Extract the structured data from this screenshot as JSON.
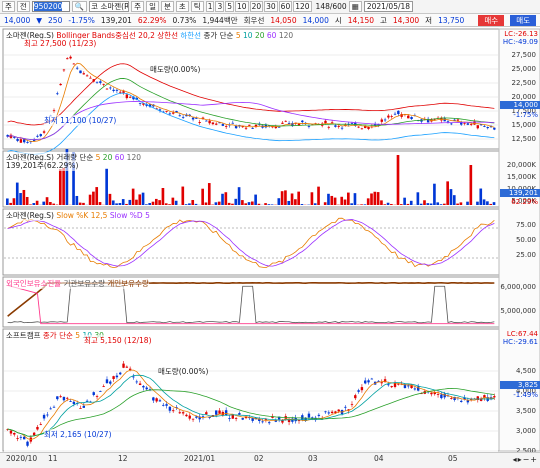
{
  "toolbar": {
    "menu_label": "주",
    "menu2_label": "전",
    "code": "950200",
    "name_short": "코 소마젠(Reg",
    "btn_ju": "주",
    "btn_il": "일",
    "btn_bun": "분",
    "btn_cho": "초",
    "btn_tick": "틱",
    "periods": [
      "1",
      "3",
      "5",
      "10",
      "20",
      "30",
      "60",
      "120"
    ],
    "ratio": "148/600",
    "date": "2021/05/18"
  },
  "quote": {
    "price": "14,000",
    "arrow": "▼",
    "change": "250",
    "pct": "-1.75%",
    "volume": "139,201",
    "vol_ratio": "62.29%",
    "turnover": "0.73%",
    "amount": "1,944백만",
    "label_hoejeon": "회우선",
    "bid": "14,050",
    "ask": "14,000",
    "open_label": "시",
    "open": "14,150",
    "high_label": "고",
    "high": "14,300",
    "low_label": "저",
    "low": "13,750",
    "buy": "매수",
    "sell": "매도"
  },
  "panel1": {
    "legend": [
      "소마젠(Reg.S)",
      "Bollinger Bands중심선 20,2",
      "상한선",
      "하한선",
      "종가 단순",
      "5",
      "10",
      "20",
      "60",
      "120"
    ],
    "max_label": "최고 27,500 (11/23)",
    "min_label": "최저 11,100 (10/27)",
    "mid_label": "매도량(0.00%)",
    "lc": "LC:-26.13",
    "hc": "HC:-49.09",
    "cur": "14,000",
    "cur_pct": "-1.75%",
    "ticks": [
      "27,500",
      "25,000",
      "22,500",
      "20,000",
      "17,500",
      "15,000",
      "12,500"
    ]
  },
  "panel2": {
    "legend": [
      "소마젠(Reg.S) 거래량",
      "단순",
      "5",
      "20",
      "60",
      "120"
    ],
    "sub": "139,201주(62.29%)",
    "cur": "139,201",
    "cur_pct": "62.29%",
    "ticks": [
      "20,000K",
      "15,000K",
      "10,000K",
      "5,000K"
    ]
  },
  "panel3": {
    "legend": [
      "소마젠(Reg.S)",
      "Slow %K 12,5",
      "Slow %D 5"
    ],
    "ticks": [
      "75.00",
      "50.00",
      "25.00"
    ]
  },
  "panel4": {
    "legend": [
      "외국인보유소진율",
      "기관보유수량",
      "개인보유수량"
    ],
    "ticks": [
      "6,000,000",
      "5,000,000"
    ]
  },
  "panel5": {
    "legend": [
      "소프트캠프",
      "종가 단순",
      "5",
      "10",
      "30"
    ],
    "max_label": "최고 5,150 (12/18)",
    "min_label": "최저 2,165 (10/27)",
    "mid_label": "매도량(0.00%)",
    "lc": "LC:67.44",
    "hc": "HC:-29.61",
    "cur": "3,825",
    "cur_pct": "-1.49%",
    "ticks": [
      "4,500",
      "4,000",
      "3,500",
      "3,000",
      "2,500"
    ]
  },
  "xaxis": [
    "2020/10",
    "11",
    "12",
    "2021/01",
    "02",
    "03",
    "04",
    "05"
  ],
  "colors": {
    "up": "#e00000",
    "down": "#0037d6",
    "ma5": "#e87c00",
    "ma20": "#2aa02a",
    "ma60": "#9b30ff",
    "boll": "#e00000",
    "low_band": "#1aa0ff"
  }
}
